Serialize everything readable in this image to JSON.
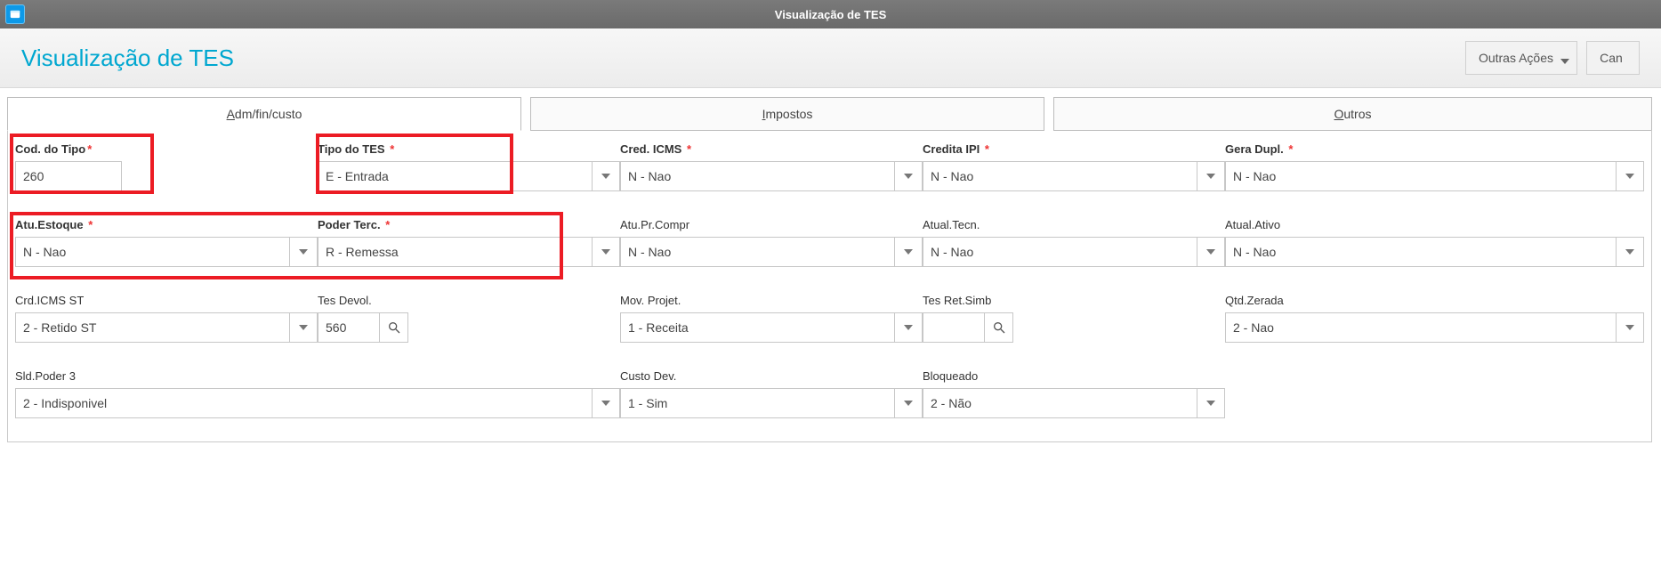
{
  "window": {
    "title": "Visualização de TES"
  },
  "header": {
    "title": "Visualização de TES",
    "actions": {
      "other": "Outras Ações",
      "cancel": "Can"
    }
  },
  "tabs": [
    {
      "pre": "A",
      "label": "dm/fin/custo"
    },
    {
      "pre": "I",
      "label": "mpostos"
    },
    {
      "pre": "O",
      "label": "utros"
    }
  ],
  "fields": {
    "codTipo": {
      "label": "Cod. do Tipo",
      "value": "260",
      "required": true,
      "bold": true
    },
    "tipoTes": {
      "label": "Tipo do TES",
      "value": "E - Entrada",
      "required": true,
      "bold": true
    },
    "credIcms": {
      "label": "Cred. ICMS",
      "value": "N - Nao",
      "required": true,
      "bold": true
    },
    "creditaIpi": {
      "label": "Credita IPI",
      "value": "N - Nao",
      "required": true,
      "bold": true
    },
    "geraDupl": {
      "label": "Gera Dupl.",
      "value": "N - Nao",
      "required": true,
      "bold": true
    },
    "atuEstoque": {
      "label": "Atu.Estoque",
      "value": "N - Nao",
      "required": true,
      "bold": true
    },
    "poderTerc": {
      "label": "Poder Terc.",
      "value": "R - Remessa",
      "required": true,
      "bold": true
    },
    "atuPrCompr": {
      "label": "Atu.Pr.Compr",
      "value": "N - Nao",
      "required": false,
      "bold": false
    },
    "atualTecn": {
      "label": "Atual.Tecn.",
      "value": "N - Nao",
      "required": false,
      "bold": false
    },
    "atualAtivo": {
      "label": "Atual.Ativo",
      "value": "N - Nao",
      "required": false,
      "bold": false
    },
    "crdIcmsSt": {
      "label": "Crd.ICMS ST",
      "value": "2 - Retido ST",
      "required": false,
      "bold": false
    },
    "tesDevol": {
      "label": "Tes Devol.",
      "value": "560",
      "required": false,
      "bold": false
    },
    "movProjet": {
      "label": "Mov. Projet.",
      "value": "1 - Receita",
      "required": false,
      "bold": false
    },
    "tesRetSimb": {
      "label": "Tes Ret.Simb",
      "value": "",
      "required": false,
      "bold": false
    },
    "qtdZerada": {
      "label": "Qtd.Zerada",
      "value": "2 - Nao",
      "required": false,
      "bold": false
    },
    "sldPoder3": {
      "label": "Sld.Poder 3",
      "value": "2 - Indisponivel",
      "required": false,
      "bold": false
    },
    "custoDev": {
      "label": "Custo Dev.",
      "value": "1 - Sim",
      "required": false,
      "bold": false
    },
    "bloqueado": {
      "label": "Bloqueado",
      "value": "2 - Não",
      "required": false,
      "bold": false
    }
  }
}
